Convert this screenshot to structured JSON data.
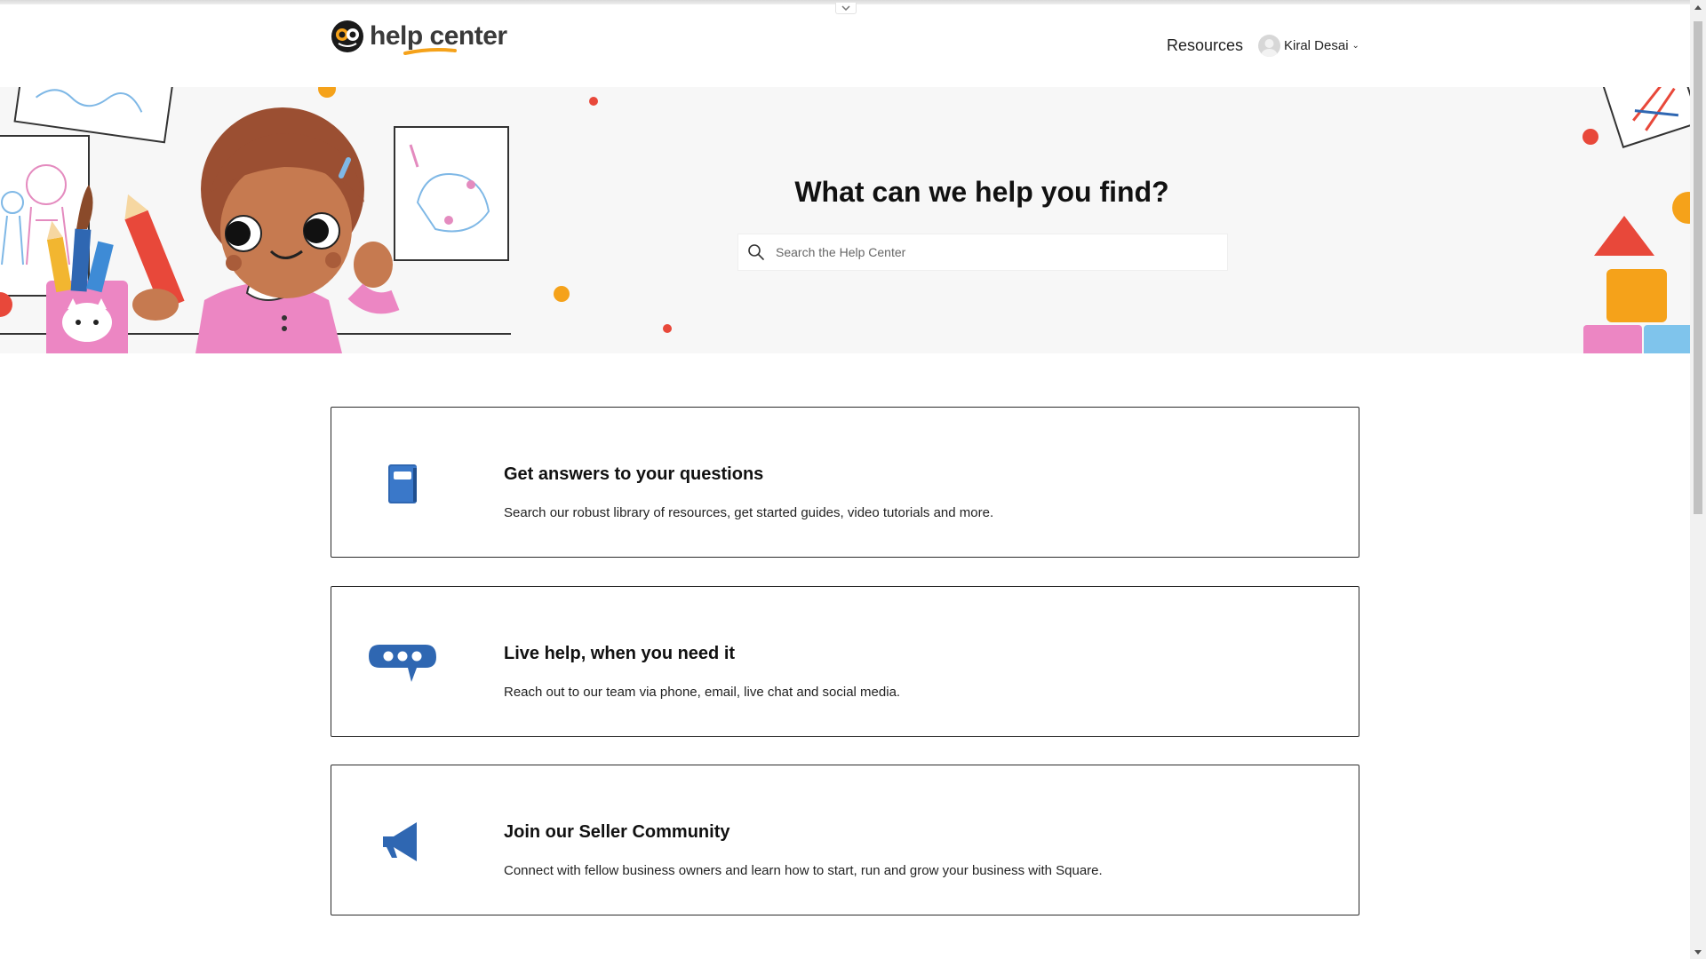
{
  "header": {
    "logo_text": "help center",
    "nav": {
      "resources_label": "Resources"
    },
    "user": {
      "name": "Kiral Desai"
    }
  },
  "hero": {
    "title": "What can we help you find?",
    "search": {
      "placeholder": "Search the Help Center",
      "value": ""
    }
  },
  "cards": [
    {
      "title": "Get answers to your questions",
      "description": "Search our robust library of resources, get started guides, video tutorials and more.",
      "icon": "book-icon"
    },
    {
      "title": "Live help, when you need it",
      "description": "Reach out to our team via phone, email, live chat and social media.",
      "icon": "chat-bubble-icon"
    },
    {
      "title": "Join our Seller Community",
      "description": "Connect with fellow business owners and learn how to start, run and grow your business with Square.",
      "icon": "megaphone-icon"
    }
  ],
  "colors": {
    "brand_orange": "#f5a21a",
    "icon_blue": "#2f67b2",
    "hero_bg": "#f7f7f7"
  }
}
